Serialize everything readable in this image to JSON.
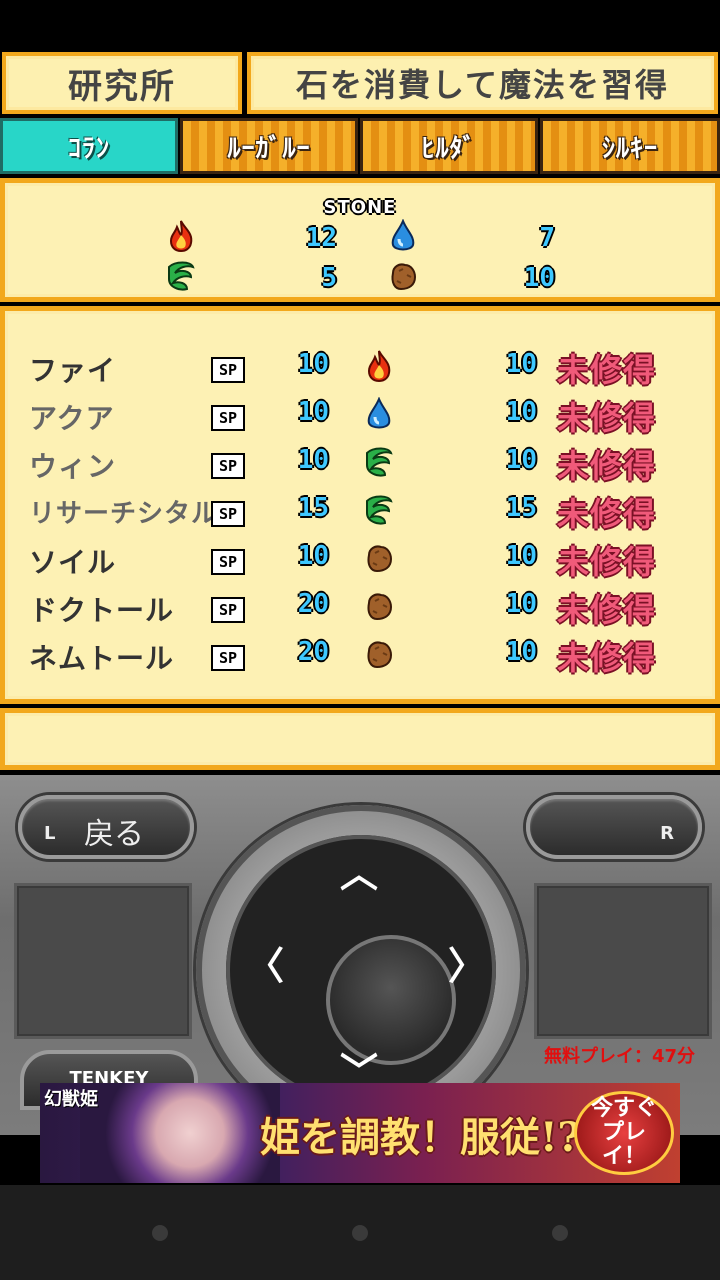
{
  "header": {
    "left_title": "研究所",
    "right_title": "石を消費して魔法を習得"
  },
  "tabs": [
    {
      "label": "ｺﾗﾝ",
      "active": true
    },
    {
      "label": "ﾙｰｶﾞﾙｰ",
      "active": false
    },
    {
      "label": "ﾋﾙﾀﾞ",
      "active": false
    },
    {
      "label": "ｼﾙｷｰ",
      "active": false
    }
  ],
  "stone": {
    "title": "STONE",
    "fire": "12",
    "water": "7",
    "wind": "5",
    "earth": "10"
  },
  "spells": [
    {
      "name": "ファイ",
      "sp_label": "SP",
      "sp": "10",
      "element": "fire",
      "cost": "10",
      "status": "未修得",
      "dim": false
    },
    {
      "name": "アクア",
      "sp_label": "SP",
      "sp": "10",
      "element": "water",
      "cost": "10",
      "status": "未修得",
      "dim": true
    },
    {
      "name": "ウィン",
      "sp_label": "SP",
      "sp": "10",
      "element": "wind",
      "cost": "10",
      "status": "未修得",
      "dim": true
    },
    {
      "name": "リサーチシタル",
      "sp_label": "SP",
      "sp": "15",
      "element": "wind",
      "cost": "15",
      "status": "未修得",
      "dim": true
    },
    {
      "name": "ソイル",
      "sp_label": "SP",
      "sp": "10",
      "element": "earth",
      "cost": "10",
      "status": "未修得",
      "dim": false
    },
    {
      "name": "ドクトール",
      "sp_label": "SP",
      "sp": "20",
      "element": "earth",
      "cost": "10",
      "status": "未修得",
      "dim": false
    },
    {
      "name": "ネムトール",
      "sp_label": "SP",
      "sp": "20",
      "element": "earth",
      "cost": "10",
      "status": "未修得",
      "dim": false
    }
  ],
  "controller": {
    "back_label": "戻る",
    "l_label": "L",
    "r_label": "R",
    "tenkey_label": "TENKEY",
    "free_play": "無料プレイ：47分"
  },
  "ad": {
    "brand": "幻獣姫",
    "title": "姫を調教！服従!?",
    "cta": "今すぐプレイ！"
  },
  "colors": {
    "panel_bg": "#fdf1b4",
    "panel_border": "#f2a81c",
    "active_tab": "#28d6c8",
    "number": "#3ec8ff",
    "status": "#f05a7a"
  }
}
